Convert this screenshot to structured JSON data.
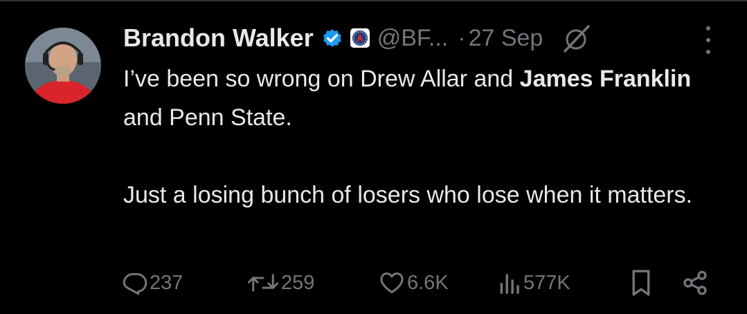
{
  "tweet": {
    "author": {
      "name": "Brandon Walker",
      "handle": "@BF...",
      "verified_color": "#1d9bf0"
    },
    "time": "27 Sep",
    "separator": "·",
    "text": {
      "line1_part1": "I’ve been so wrong on Drew Allar and ",
      "line1_bold": "James Franklin",
      "line1_part2": " and Penn State.",
      "para2": "Just a losing bunch of losers who lose when it matters."
    },
    "actions": {
      "replies": "237",
      "reposts": "259",
      "likes": "6.6K",
      "views": "577K"
    },
    "icons": [
      "verified-badge-icon",
      "affiliate-badge-icon",
      "grok-icon",
      "more-icon",
      "reply-icon",
      "repost-icon",
      "like-icon",
      "views-icon",
      "bookmark-icon",
      "share-icon"
    ]
  }
}
